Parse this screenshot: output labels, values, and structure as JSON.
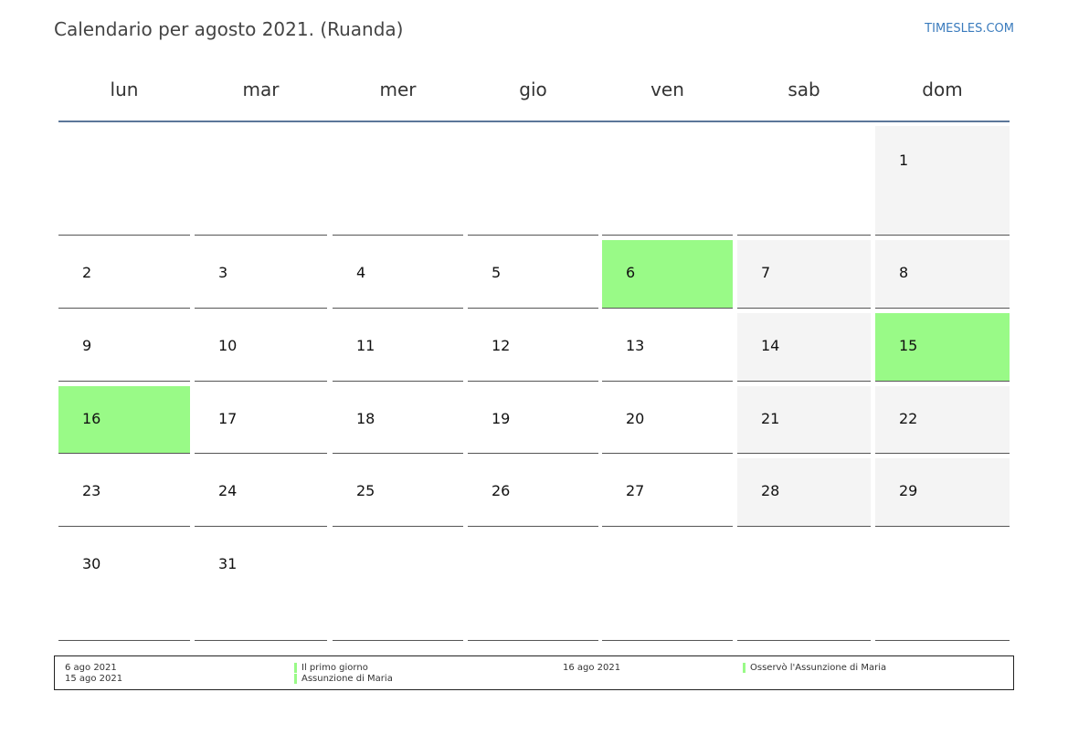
{
  "header": {
    "title": "Calendario per agosto 2021. (Ruanda)",
    "brand": "TIMESLES.COM"
  },
  "weekdays": [
    "lun",
    "mar",
    "mer",
    "gio",
    "ven",
    "sab",
    "dom"
  ],
  "colors": {
    "holiday": "#99fa87",
    "weekend": "#f4f4f4",
    "header_rule": "#5b7799",
    "brand": "#3a7bbd"
  },
  "weeks": [
    [
      null,
      null,
      null,
      null,
      null,
      null,
      "1"
    ],
    [
      "2",
      "3",
      "4",
      "5",
      "6",
      "7",
      "8"
    ],
    [
      "9",
      "10",
      "11",
      "12",
      "13",
      "14",
      "15"
    ],
    [
      "16",
      "17",
      "18",
      "19",
      "20",
      "21",
      "22"
    ],
    [
      "23",
      "24",
      "25",
      "26",
      "27",
      "28",
      "29"
    ],
    [
      "30",
      "31",
      null,
      null,
      null,
      null,
      null
    ]
  ],
  "holidays": [
    "6",
    "15",
    "16"
  ],
  "legend": {
    "col1_dates": [
      "6 ago 2021",
      "15 ago 2021"
    ],
    "col1_names": [
      "Il primo giorno",
      "Assunzione di Maria"
    ],
    "col2_dates": [
      "16 ago 2021"
    ],
    "col2_names": [
      "Osservò l'Assunzione di Maria"
    ]
  }
}
